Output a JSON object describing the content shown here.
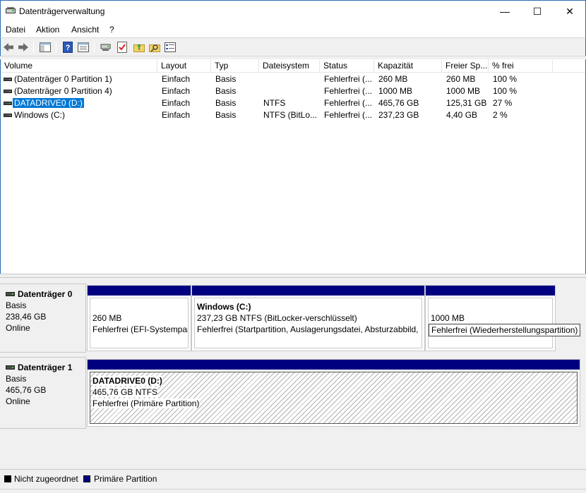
{
  "window": {
    "title": "Datenträgerverwaltung",
    "minimize_glyph": "—",
    "maximize_glyph": "☐",
    "close_glyph": "✕"
  },
  "menu": [
    "Datei",
    "Aktion",
    "Ansicht",
    "?"
  ],
  "toolbar_icons": [
    "back-arrow-icon",
    "forward-arrow-icon",
    "console-tree-icon",
    "help-icon",
    "properties-icon",
    "connect-icon",
    "checklist-icon",
    "folder-up-icon",
    "search-folder-icon",
    "settings-list-icon"
  ],
  "columns": [
    "Volume",
    "Layout",
    "Typ",
    "Dateisystem",
    "Status",
    "Kapazität",
    "Freier Sp...",
    "% frei"
  ],
  "volumes": [
    {
      "volume": "(Datenträger 0 Partition 1)",
      "layout": "Einfach",
      "typ": "Basis",
      "fs": "",
      "status": "Fehlerfrei (...",
      "capacity": "260 MB",
      "free": "260 MB",
      "pct": "100 %"
    },
    {
      "volume": "(Datenträger 0 Partition 4)",
      "layout": "Einfach",
      "typ": "Basis",
      "fs": "",
      "status": "Fehlerfrei (...",
      "capacity": "1000 MB",
      "free": "1000 MB",
      "pct": "100 %"
    },
    {
      "volume": "DATADRIVE0 (D:)",
      "layout": "Einfach",
      "typ": "Basis",
      "fs": "NTFS",
      "status": "Fehlerfrei (...",
      "capacity": "465,76 GB",
      "free": "125,31 GB",
      "pct": "27 %"
    },
    {
      "volume": "Windows (C:)",
      "layout": "Einfach",
      "typ": "Basis",
      "fs": "NTFS (BitLo...",
      "status": "Fehlerfrei (...",
      "capacity": "237,23 GB",
      "free": "4,40 GB",
      "pct": "2 %"
    }
  ],
  "disks": [
    {
      "name": "Datenträger 0",
      "type": "Basis",
      "size": "238,46 GB",
      "state": "Online",
      "partitions": [
        {
          "title": "",
          "line1": "260 MB",
          "line2": "Fehlerfrei (EFI-Systempar"
        },
        {
          "title": "Windows  (C:)",
          "line1": "237,23 GB NTFS (BitLocker-verschlüsselt)",
          "line2": "Fehlerfrei (Startpartition, Auslagerungsdatei, Absturzabbild,"
        },
        {
          "title": "",
          "line1": "1000 MB",
          "line2": "Fehlerfrei (Wiederherstellungspartition)"
        }
      ]
    },
    {
      "name": "Datenträger 1",
      "type": "Basis",
      "size": "465,76 GB",
      "state": "Online",
      "partitions": [
        {
          "title": "DATADRIVE0  (D:)",
          "line1": "465,76 GB NTFS",
          "line2": "Fehlerfrei (Primäre Partition)"
        }
      ]
    }
  ],
  "legend": [
    {
      "label": "Nicht zugeordnet",
      "color": "#000000"
    },
    {
      "label": "Primäre Partition",
      "color": "#000080"
    }
  ],
  "colors": {
    "selection": "#0078d7",
    "primary_partition": "#000080",
    "unallocated": "#000000"
  }
}
